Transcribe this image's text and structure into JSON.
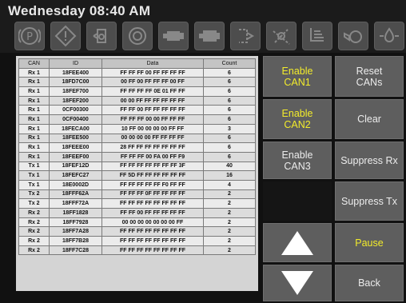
{
  "header": {
    "datetime": "Wednesday 08:40 AM",
    "icons": [
      "parking-brake-icon",
      "warning-icon",
      "coolant-level-icon",
      "tire-icon",
      "engine-icon",
      "engine-warning-icon",
      "battery-gauge-icon",
      "fan-icon",
      "exhaust-icon",
      "oil-can-icon",
      "oil-drop-icon"
    ]
  },
  "table": {
    "columns": [
      "CAN",
      "ID",
      "Data",
      "Count"
    ],
    "rows": [
      [
        "Rx 1",
        "18FEE400",
        "FF FF FF 00 FF FF FF FF",
        "6"
      ],
      [
        "Rx 1",
        "18FD7C00",
        "00 FF 00 FF FF FF 00 FF",
        "6"
      ],
      [
        "Rx 1",
        "18FEF700",
        "FF FF FF FF 0E 01 FF FF",
        "6"
      ],
      [
        "Rx 1",
        "18FEF200",
        "00 00 FF FF FF FF FF FF",
        "6"
      ],
      [
        "Rx 1",
        "0CF00300",
        "FF FF 00 FF FF FF FF FF",
        "6"
      ],
      [
        "Rx 1",
        "0CF00400",
        "FF FF FF 00 00 FF FF FF",
        "6"
      ],
      [
        "Rx 1",
        "18FECA00",
        "10 FF 00 00 00 00 FF FF",
        "3"
      ],
      [
        "Rx 1",
        "18FEE500",
        "00 00 00 00 FF FF FF FF",
        "6"
      ],
      [
        "Rx 1",
        "18FEEE00",
        "28 FF FF FF FF FF FF FF",
        "6"
      ],
      [
        "Rx 1",
        "18FEEF00",
        "FF FF FF 00 FA 00 FF F9",
        "6"
      ],
      [
        "Tx 1",
        "18FEF12D",
        "FF FF FF FF FF FF FF 3F",
        "40"
      ],
      [
        "Tx 1",
        "18FEFC27",
        "FF 5D FF FF FF FF FF FF",
        "16"
      ],
      [
        "Tx 1",
        "18E0002D",
        "FF FF FF FF FF F0 FF FF",
        "4"
      ],
      [
        "Tx 2",
        "18FFF62A",
        "FF FF FF 0F FF FF FF FF",
        "2"
      ],
      [
        "Tx 2",
        "18FFF72A",
        "FF FF FF FF FF FF FF FF",
        "2"
      ],
      [
        "Rx 2",
        "18FF1828",
        "FF FF 00 FF FF FF FF FF",
        "2"
      ],
      [
        "Rx 2",
        "18FF7928",
        "00 00 00 00 00 00 00 FF",
        "2"
      ],
      [
        "Rx 2",
        "18FF7A28",
        "FF FF FF FF FF FF FF FF",
        "2"
      ],
      [
        "Rx 2",
        "18FF7B28",
        "FF FF FF FF FF FF FF FF",
        "2"
      ],
      [
        "Rx 2",
        "18FF7C28",
        "FF FF FF FF FF FF FF FF",
        "2"
      ]
    ]
  },
  "buttons": {
    "enable_can1": [
      "Enable",
      "CAN1"
    ],
    "reset_cans": [
      "Reset",
      "CANs"
    ],
    "enable_can2": [
      "Enable",
      "CAN2"
    ],
    "clear": "Clear",
    "enable_can3": [
      "Enable",
      "CAN3"
    ],
    "suppress_rx": "Suppress Rx",
    "suppress_tx": "Suppress Tx",
    "pause": "Pause",
    "back": "Back"
  },
  "colors": {
    "highlight_text": "#f3ec2b",
    "button_bg": "#5e5e5e",
    "background": "#111111"
  }
}
